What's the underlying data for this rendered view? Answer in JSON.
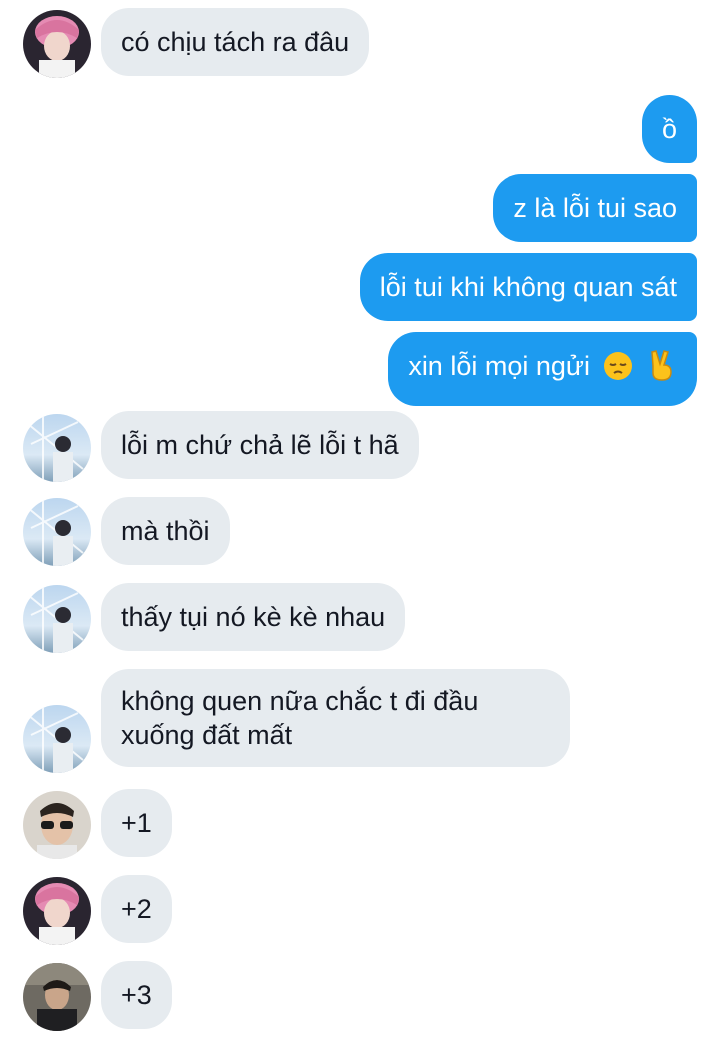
{
  "messages": [
    {
      "side": "in",
      "avatar": "pink-hair-avatar",
      "text": "có chịu tách ra đâu"
    },
    {
      "side": "out",
      "text": "ồ"
    },
    {
      "side": "out",
      "text": "z là lỗi tui sao"
    },
    {
      "side": "out",
      "text": "lỗi tui khi không quan sát"
    },
    {
      "side": "out",
      "text": "xin lỗi mọi ngửi",
      "emoji": [
        "pensive-face",
        "victory-hand"
      ]
    },
    {
      "side": "in",
      "avatar": "ferris-wheel-avatar",
      "text": "lỗi m chứ chả lẽ lỗi t hã"
    },
    {
      "side": "in",
      "avatar": "ferris-wheel-avatar",
      "text": "mà thồi"
    },
    {
      "side": "in",
      "avatar": "ferris-wheel-avatar",
      "text": "thấy tụi nó kè kè nhau"
    },
    {
      "side": "in",
      "avatar": "ferris-wheel-avatar",
      "text": "không quen nữa chắc t đi đầu xuống đất mất"
    },
    {
      "side": "in",
      "avatar": "sunglasses-avatar",
      "text": "+1"
    },
    {
      "side": "in",
      "avatar": "pink-hair-avatar",
      "text": "+2"
    },
    {
      "side": "in",
      "avatar": "dark-portrait-avatar",
      "text": "+3"
    }
  ],
  "colors": {
    "incoming_bubble": "#e6ebef",
    "outgoing_bubble": "#1d9bf0",
    "incoming_text": "#141823",
    "outgoing_text": "#ffffff"
  }
}
